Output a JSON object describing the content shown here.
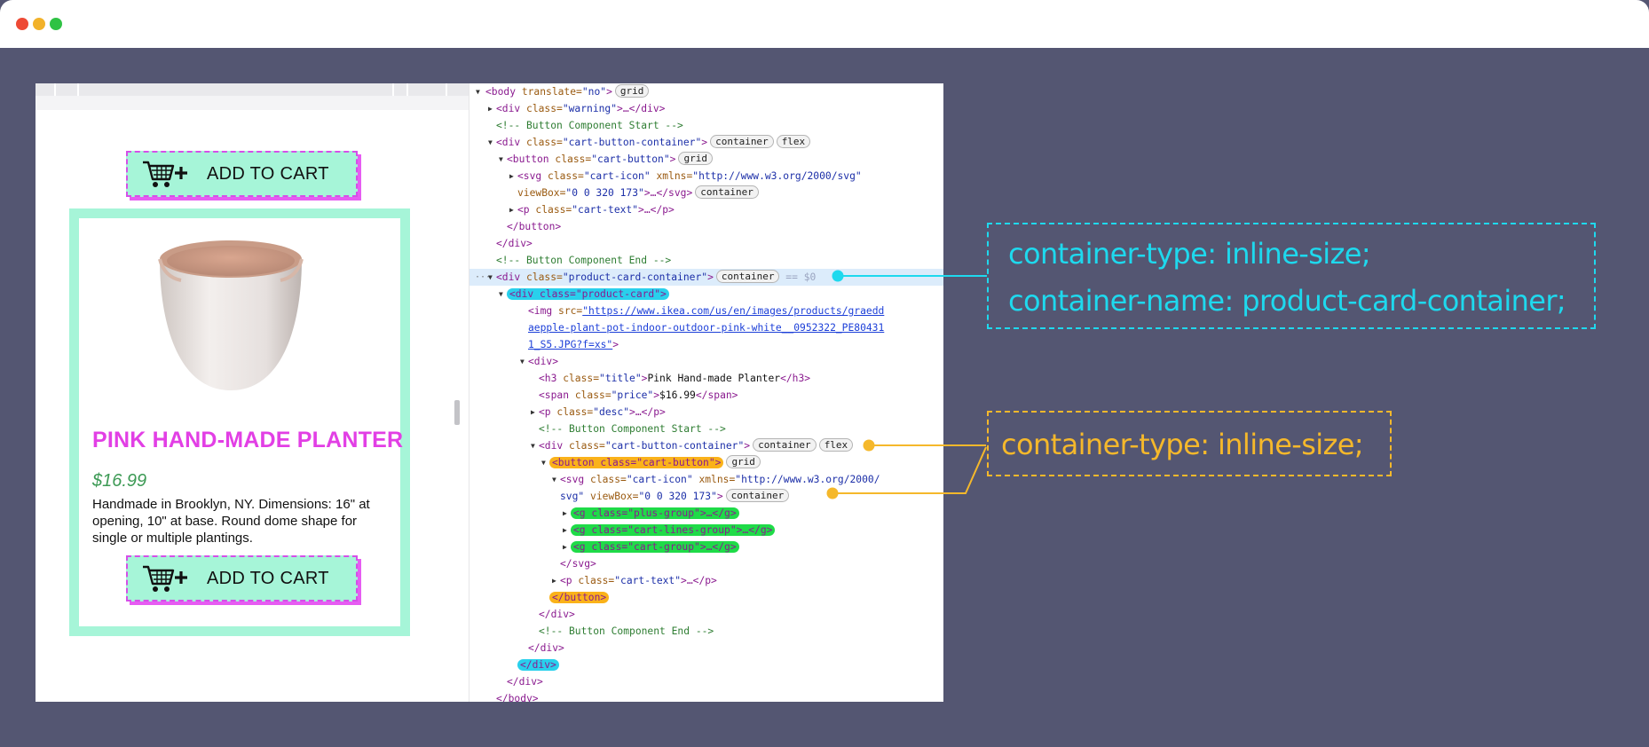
{
  "window": {
    "controls": [
      "close",
      "minimize",
      "maximize"
    ]
  },
  "page": {
    "top_button": {
      "label": "ADD TO CART",
      "icon": "cart-plus-icon"
    },
    "product": {
      "title": "PINK HAND-MADE PLANTER",
      "price": "$16.99",
      "description": "Handmade in Brooklyn, NY. Dimensions: 16\" at opening, 10\" at base. Round dome shape for single or multiple plantings.",
      "button_label": "ADD TO CART"
    }
  },
  "devtools": {
    "lines": {
      "l1_tag": "<body",
      "l1_attr": " translate=",
      "l1_val": "\"no\"",
      "l1_end": ">",
      "l1_badge": "grid",
      "l2_tag": "<div",
      "l2_attr": " class=",
      "l2_val": "\"warning\"",
      "l2_end": ">…</div>",
      "l3": "<!-- Button Component Start -->",
      "l4_tag": "<div",
      "l4_attr": " class=",
      "l4_val": "\"cart-button-container\"",
      "l4_end": ">",
      "l4_badge1": "container",
      "l4_badge2": "flex",
      "l5_tag": "<button",
      "l5_attr": " class=",
      "l5_val": "\"cart-button\"",
      "l5_end": ">",
      "l5_badge": "grid",
      "l6_tag": "<svg",
      "l6_attr1": " class=",
      "l6_val1": "\"cart-icon\"",
      "l6_attr2": " xmlns=",
      "l6_val2": "\"http://www.w3.org/2000/svg\"",
      "l7_attr": "viewBox=",
      "l7_val": "\"0 0 320 173\"",
      "l7_end": ">…</svg>",
      "l7_badge": "container",
      "l8_tag": "<p",
      "l8_attr": " class=",
      "l8_val": "\"cart-text\"",
      "l8_end": ">…</p>",
      "l9": "</button>",
      "l10": "</div>",
      "l11": "<!-- Button Component End -->",
      "l12_tag": "<div",
      "l12_attr": " class=",
      "l12_val": "\"product-card-container\"",
      "l12_end": ">",
      "l12_badge": "container",
      "l12_tail": "== $0",
      "l13": "<div class=\"product-card\">",
      "l14_tag": "<img",
      "l14_attr": " src=",
      "l14_val": "\"https://www.ikea.com/us/en/images/products/graedd",
      "l15_val": "aepple-plant-pot-indoor-outdoor-pink-white__0952322_PE80431",
      "l16_val": "1_S5.JPG?f=xs\"",
      "l16_end": ">",
      "l17": "<div>",
      "l18_tag": "<h3",
      "l18_attr": " class=",
      "l18_val": "\"title\"",
      "l18_end": ">",
      "l18_text": "Pink Hand-made Planter",
      "l18_close": "</h3>",
      "l19_tag": "<span",
      "l19_attr": " class=",
      "l19_val": "\"price\"",
      "l19_end": ">",
      "l19_text": "$16.99",
      "l19_close": "</span>",
      "l20_tag": "<p",
      "l20_attr": " class=",
      "l20_val": "\"desc\"",
      "l20_end": ">…</p>",
      "l21": "<!-- Button Component Start -->",
      "l22_tag": "<div",
      "l22_attr": " class=",
      "l22_val": "\"cart-button-container\"",
      "l22_end": ">",
      "l22_badge1": "container",
      "l22_badge2": "flex",
      "l23": "<button class=\"cart-button\">",
      "l23_badge": "grid",
      "l24_tag": "<svg",
      "l24_attr1": " class=",
      "l24_val1": "\"cart-icon\"",
      "l24_attr2": " xmlns=",
      "l24_val2": "\"http://www.w3.org/2000/",
      "l25_val": "svg\"",
      "l25_attr": " viewBox=",
      "l25_val2": "\"0 0 320 173\"",
      "l25_end": ">",
      "l25_badge": "container",
      "l26": "<g class=\"plus-group\">…</g>",
      "l27": "<g class=\"cart-lines-group\">…</g>",
      "l28": "<g class=\"cart-group\">…</g>",
      "l29": "</svg>",
      "l30_tag": "<p",
      "l30_attr": " class=",
      "l30_val": "\"cart-text\"",
      "l30_end": ">…</p>",
      "l31": "</button>",
      "l32": "</div>",
      "l33": "<!-- Button Component End -->",
      "l34": "</div>",
      "l35": "</div>",
      "l36": "</div>",
      "l37": "</body>"
    }
  },
  "annotations": {
    "cyan_line1": "container-type: inline-size;",
    "cyan_line2": "container-name: product-card-container;",
    "orange_line1": "container-type: inline-size;"
  },
  "colors": {
    "background": "#545672",
    "button_fill": "#a6f5d8",
    "button_shadow": "#e65cf2",
    "title": "#e23fe5",
    "price": "#3d9a55",
    "cyan_accent": "#1ed9ee",
    "orange_accent": "#f5b82b",
    "green_highlight": "#1fdb48"
  }
}
